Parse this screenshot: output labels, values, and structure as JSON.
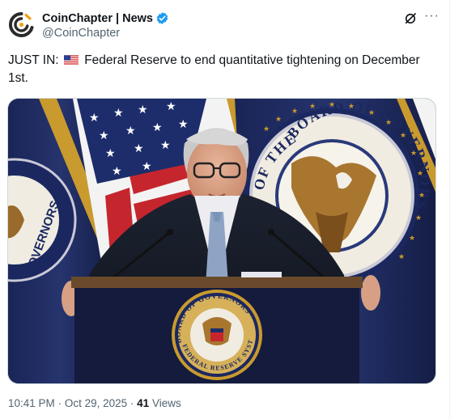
{
  "author": {
    "display_name": "CoinChapter | News",
    "handle": "@CoinChapter",
    "avatar_icon": "coinchapter-logo-icon",
    "verified_icon": "verified-badge-icon",
    "verified_color": "#1d9bf0"
  },
  "actions": {
    "grok_icon": "grok-icon",
    "more_label": "···"
  },
  "tweet": {
    "prefix": "JUST IN:",
    "flag_icon": "us-flag-icon",
    "body": "Federal Reserve to end quantitative tightening on December 1st."
  },
  "media": {
    "alt": "Photo of Federal Reserve chair at podium in front of flags and Board of Governors seal",
    "seal_text_top": "BOARD OF GOVERNORS",
    "seal_text_bottom": "FEDERAL RESERVE SYSTEM",
    "seal_prefix": "OF THE"
  },
  "meta": {
    "time": "10:41 PM",
    "separator": "·",
    "date": "Oct 29, 2025",
    "views_count": "41",
    "views_label": "Views"
  }
}
